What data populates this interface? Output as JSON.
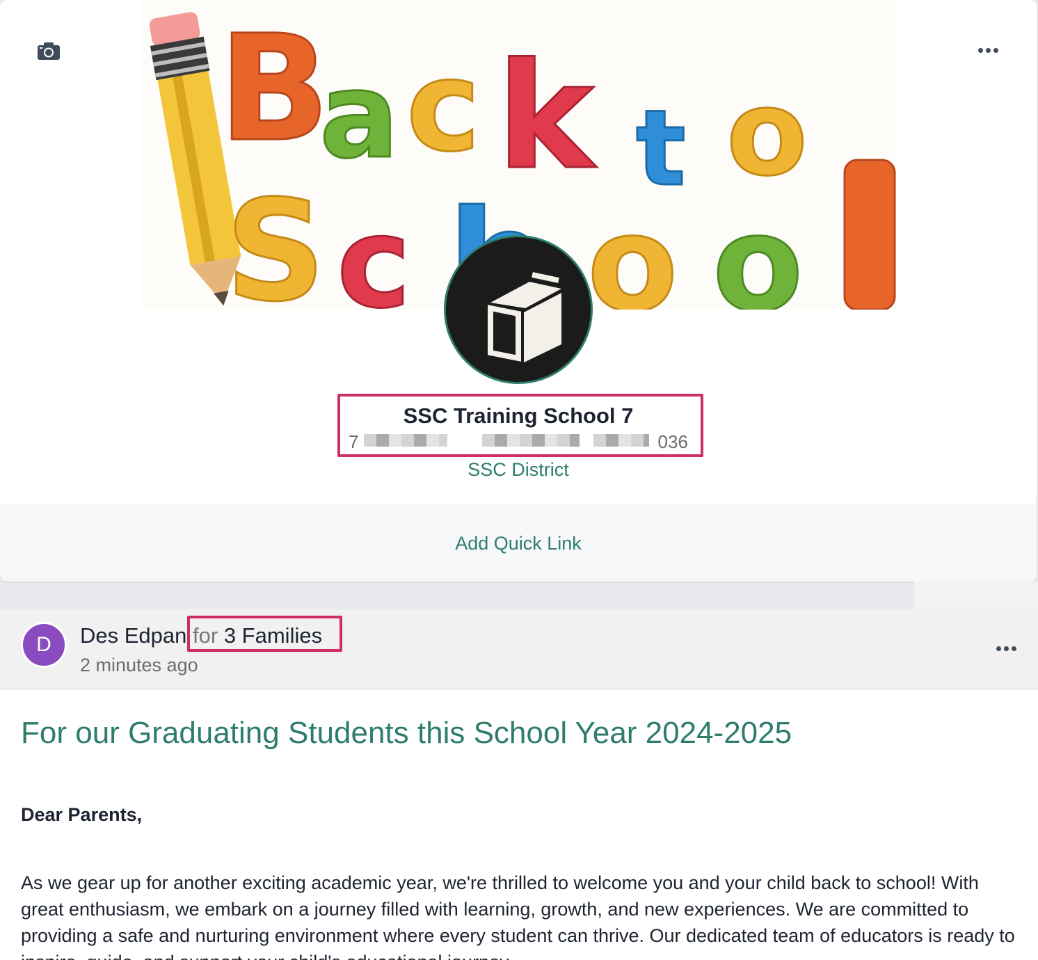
{
  "school_card": {
    "cover_alt": "Back to School",
    "camera_icon": "camera-icon",
    "more_icon": "more-horizontal-icon",
    "school_name": "SSC Training School 7",
    "address_visible_start": "7",
    "address_visible_end": "036",
    "district": "SSC District",
    "add_quick_link": "Add Quick Link",
    "logo_icon": "book-icon"
  },
  "post": {
    "author_initial": "D",
    "author_name": "Des Edpan",
    "for_word": "for",
    "audience": "3 Families",
    "timestamp": "2 minutes ago",
    "more_icon": "more-horizontal-icon",
    "title": "For our Graduating Students this School Year 2024-2025",
    "salutation": "Dear Parents,",
    "body": "As we gear up for another exciting academic year, we're thrilled to welcome you and your child back to school! With great enthusiasm, we embark on a journey filled with learning, growth, and new experiences. We are committed to providing a safe and nurturing environment where every student can thrive. Our dedicated team of educators is ready to inspire, guide, and support your child's educational journey."
  },
  "colors": {
    "accent_green": "#2e7d6c",
    "highlight_red": "#cf2f5e",
    "avatar_purple": "#8a4ac0"
  }
}
